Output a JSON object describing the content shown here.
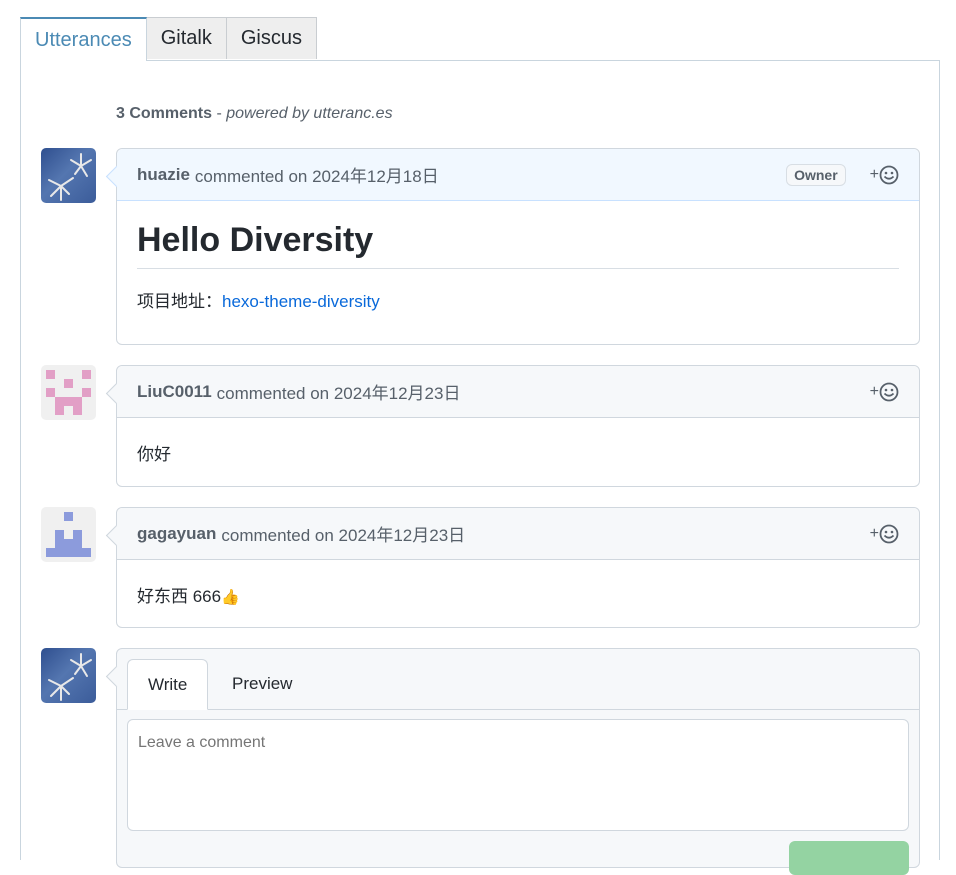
{
  "tabs": [
    "Utterances",
    "Gitalk",
    "Giscus"
  ],
  "header": {
    "count": "3 Comments",
    "powered": "powered by utteranc.es",
    "separator": " - "
  },
  "comments": [
    {
      "user": "huazie",
      "action": "commented on 2024年12月18日",
      "badge": "Owner",
      "heading": "Hello Diversity",
      "label": "项目地址：",
      "link": "hexo-theme-diversity"
    },
    {
      "user": "LiuC0011",
      "action": "commented on 2024年12月23日",
      "body": "你好"
    },
    {
      "user": "gagayuan",
      "action": "commented on 2024年12月23日",
      "body": "好东西 666",
      "emoji": "👍"
    }
  ],
  "reaction": {
    "plus": "+"
  },
  "editor": {
    "write": "Write",
    "preview": "Preview",
    "placeholder": "Leave a comment"
  },
  "colors": {
    "accent": "#4b8ab4",
    "link": "#0969da",
    "submit": "#94d3a2"
  }
}
